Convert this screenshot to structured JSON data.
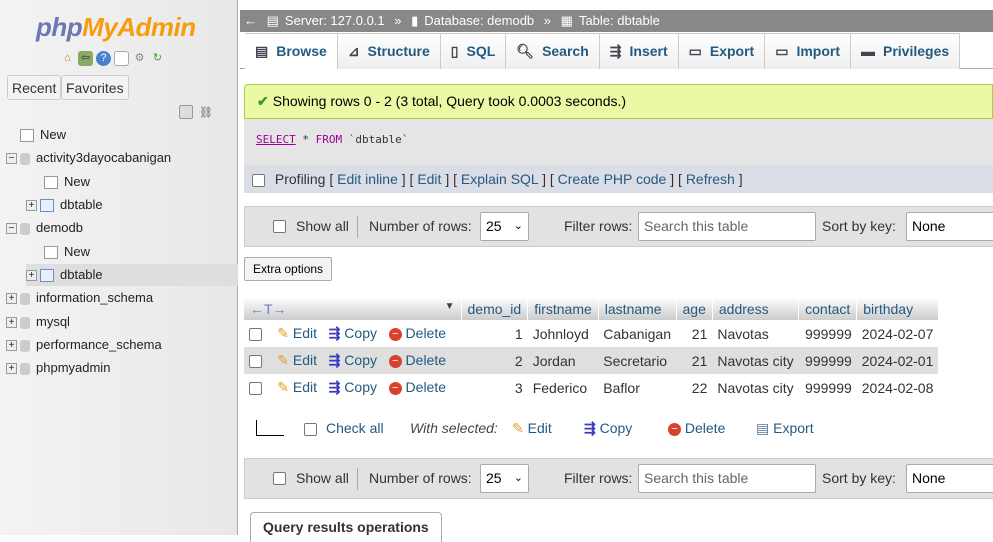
{
  "sidebar": {
    "logo": {
      "php": "php",
      "myadmin": "MyAdmin"
    },
    "recent": "Recent",
    "favorites": "Favorites",
    "tree": [
      {
        "label": "New",
        "level": 0
      },
      {
        "label": "activity3dayocabanigan",
        "level": 0
      },
      {
        "label": "New",
        "level": 1
      },
      {
        "label": "dbtable",
        "level": 1
      },
      {
        "label": "demodb",
        "level": 0
      },
      {
        "label": "New",
        "level": 1
      },
      {
        "label": "dbtable",
        "level": 1,
        "selected": true
      },
      {
        "label": "information_schema",
        "level": 0
      },
      {
        "label": "mysql",
        "level": 0
      },
      {
        "label": "performance_schema",
        "level": 0
      },
      {
        "label": "phpmyadmin",
        "level": 0
      }
    ]
  },
  "breadcrumb": {
    "server": "Server: 127.0.0.1",
    "database": "Database: demodb",
    "table": "Table: dbtable",
    "sep": "»"
  },
  "tabs": [
    "Browse",
    "Structure",
    "SQL",
    "Search",
    "Insert",
    "Export",
    "Import",
    "Privileges"
  ],
  "message": "Showing rows 0 - 2 (3 total, Query took 0.0003 seconds.)",
  "sql": {
    "select": "SELECT",
    "star": "*",
    "from": "FROM",
    "table": "`dbtable`"
  },
  "profiling": {
    "label": "Profiling",
    "links": [
      "Edit inline",
      "Edit",
      "Explain SQL",
      "Create PHP code",
      "Refresh"
    ]
  },
  "nav": {
    "show_all": "Show all",
    "number_of_rows": "Number of rows:",
    "rows_value": "25",
    "filter_rows": "Filter rows:",
    "filter_placeholder": "Search this table",
    "sort_by_key": "Sort by key:",
    "sort_value": "None"
  },
  "extra_options": "Extra options",
  "table": {
    "columns": [
      "demo_id",
      "firstname",
      "lastname",
      "age",
      "address",
      "contact",
      "birthday"
    ],
    "actions": {
      "edit": "Edit",
      "copy": "Copy",
      "delete": "Delete"
    },
    "rows": [
      [
        "1",
        "Johnloyd",
        "Cabanigan",
        "21",
        "Navotas",
        "999999",
        "2024-02-07"
      ],
      [
        "2",
        "Jordan",
        "Secretario",
        "21",
        "Navotas city",
        "999999",
        "2024-02-01"
      ],
      [
        "3",
        "Federico",
        "Baflor",
        "22",
        "Navotas city",
        "999999",
        "2024-02-08"
      ]
    ]
  },
  "bulk": {
    "check_all": "Check all",
    "with_selected": "With selected:",
    "edit": "Edit",
    "copy": "Copy",
    "delete": "Delete",
    "export": "Export"
  },
  "query_results_operations": "Query results operations"
}
